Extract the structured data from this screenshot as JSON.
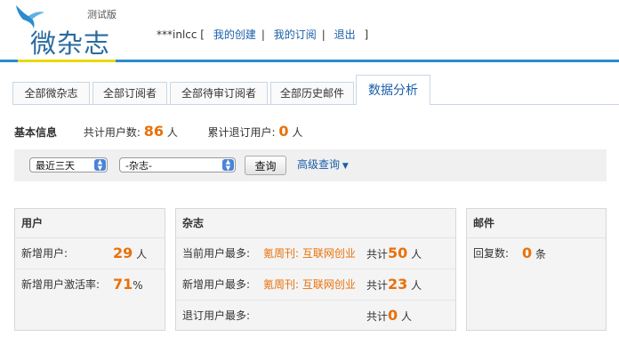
{
  "header": {
    "logo_text": "微杂志",
    "logo_tag": "测试版",
    "username": "***inlcc",
    "links": [
      "我的创建",
      "我的订阅",
      "退出"
    ],
    "bracket_open": "[",
    "bracket_close": "]",
    "separator": "|"
  },
  "tabs": [
    "全部微杂志",
    "全部订阅者",
    "全部待审订阅者",
    "全部历史邮件",
    "数据分析"
  ],
  "active_tab": "数据分析",
  "basic_info": {
    "title": "基本信息",
    "total_users_label": "共计用户数:",
    "total_users": "86",
    "total_users_unit": "人",
    "unsub_label": "累计退订用户:",
    "unsub": "0",
    "unsub_unit": "人"
  },
  "filter": {
    "period": "最近三天",
    "magazine": "-杂志-",
    "query_button": "查询",
    "advanced_query": "高级查询"
  },
  "panels": {
    "users": {
      "title": "用户",
      "new_users_label": "新增用户:",
      "new_users": "29",
      "new_users_unit": "人",
      "activation_label": "新增用户激活率:",
      "activation": "71",
      "activation_unit": "%"
    },
    "magazine": {
      "title": "杂志",
      "rows": [
        {
          "label": "当前用户最多:",
          "name": "氪周刊: 互联网创业",
          "prefix": "共计",
          "value": "50",
          "unit": "人"
        },
        {
          "label": "新增用户最多:",
          "name": "氪周刊: 互联网创业",
          "prefix": "共计",
          "value": "23",
          "unit": "人"
        },
        {
          "label": "退订用户最多:",
          "name": "",
          "prefix": "共计",
          "value": "0",
          "unit": "人"
        }
      ]
    },
    "mail": {
      "title": "邮件",
      "replies_label": "回复数:",
      "replies": "0",
      "replies_unit": "条"
    }
  },
  "colors": {
    "accent": "#e8710a",
    "link": "#1a5fa8",
    "header_line": "#2a8bd1"
  }
}
